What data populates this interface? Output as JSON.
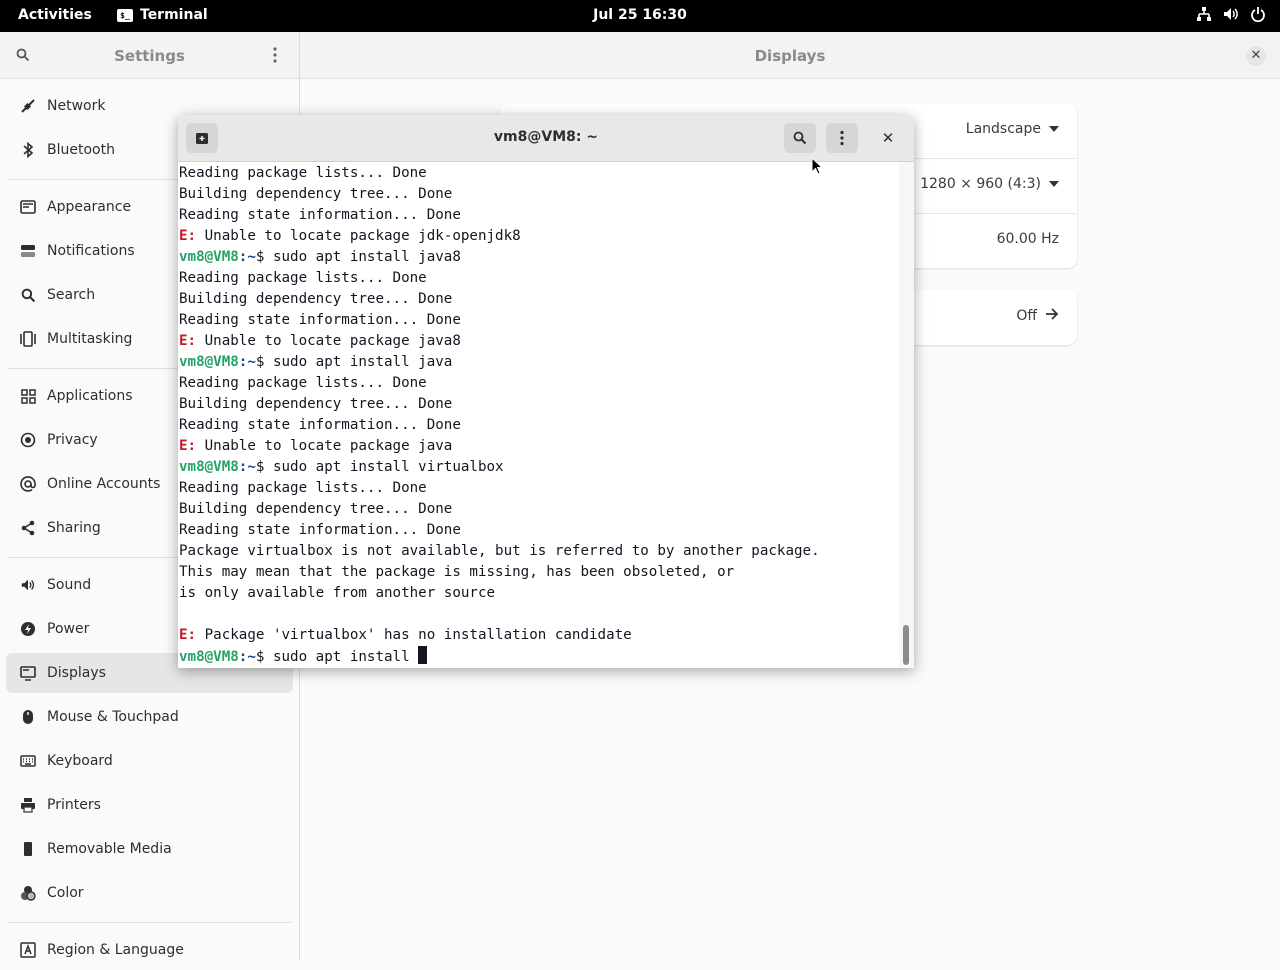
{
  "topbar": {
    "activities": "Activities",
    "app_name": "Terminal",
    "app_icon_text": "$_",
    "clock": "Jul 25  16:30"
  },
  "settings": {
    "title": "Settings",
    "nav": [
      {
        "label": "Network",
        "icon": "network-icon"
      },
      {
        "label": "Bluetooth",
        "icon": "bluetooth-icon"
      },
      {
        "label": "Appearance",
        "icon": "appearance-icon"
      },
      {
        "label": "Notifications",
        "icon": "notifications-icon"
      },
      {
        "label": "Search",
        "icon": "search-icon"
      },
      {
        "label": "Multitasking",
        "icon": "multitasking-icon"
      },
      {
        "label": "Applications",
        "icon": "applications-icon"
      },
      {
        "label": "Privacy",
        "icon": "privacy-icon"
      },
      {
        "label": "Online Accounts",
        "icon": "online-accounts-icon"
      },
      {
        "label": "Sharing",
        "icon": "sharing-icon"
      },
      {
        "label": "Sound",
        "icon": "sound-icon"
      },
      {
        "label": "Power",
        "icon": "power-icon"
      },
      {
        "label": "Displays",
        "icon": "displays-icon",
        "active": true
      },
      {
        "label": "Mouse & Touchpad",
        "icon": "mouse-icon"
      },
      {
        "label": "Keyboard",
        "icon": "keyboard-icon"
      },
      {
        "label": "Printers",
        "icon": "printer-icon"
      },
      {
        "label": "Removable Media",
        "icon": "removable-media-icon"
      },
      {
        "label": "Color",
        "icon": "color-icon"
      },
      {
        "label": "Region & Language",
        "icon": "region-language-icon"
      }
    ]
  },
  "displays": {
    "title": "Displays",
    "orientation": "Landscape",
    "resolution": "1280 × 960 (4:3)",
    "refresh_rate": "60.00 Hz",
    "night_light": "Off"
  },
  "terminal": {
    "title": "vm8@VM8: ~",
    "prompt_user": "vm8@VM8",
    "prompt_path": ":~",
    "lines": [
      {
        "type": "out",
        "text": "Reading package lists... Done"
      },
      {
        "type": "out",
        "text": "Building dependency tree... Done"
      },
      {
        "type": "out",
        "text": "Reading state information... Done"
      },
      {
        "type": "err",
        "prefix": "E:",
        "text": " Unable to locate package jdk-openjdk8"
      },
      {
        "type": "cmd",
        "text": "$ sudo apt install java8"
      },
      {
        "type": "out",
        "text": "Reading package lists... Done"
      },
      {
        "type": "out",
        "text": "Building dependency tree... Done"
      },
      {
        "type": "out",
        "text": "Reading state information... Done"
      },
      {
        "type": "err",
        "prefix": "E:",
        "text": " Unable to locate package java8"
      },
      {
        "type": "cmd",
        "text": "$ sudo apt install java"
      },
      {
        "type": "out",
        "text": "Reading package lists... Done"
      },
      {
        "type": "out",
        "text": "Building dependency tree... Done"
      },
      {
        "type": "out",
        "text": "Reading state information... Done"
      },
      {
        "type": "err",
        "prefix": "E:",
        "text": " Unable to locate package java"
      },
      {
        "type": "cmd",
        "text": "$ sudo apt install virtualbox"
      },
      {
        "type": "out",
        "text": "Reading package lists... Done"
      },
      {
        "type": "out",
        "text": "Building dependency tree... Done"
      },
      {
        "type": "out",
        "text": "Reading state information... Done"
      },
      {
        "type": "out",
        "text": "Package virtualbox is not available, but is referred to by another package."
      },
      {
        "type": "out",
        "text": "This may mean that the package is missing, has been obsoleted, or"
      },
      {
        "type": "out",
        "text": "is only available from another source"
      },
      {
        "type": "out",
        "text": ""
      },
      {
        "type": "err",
        "prefix": "E:",
        "text": " Package 'virtualbox' has no installation candidate"
      },
      {
        "type": "cmd",
        "text": "$ sudo apt install ",
        "cursor": true
      }
    ]
  },
  "colors": {
    "prompt_user": "#26a269",
    "prompt_path": "#12488b",
    "error": "#c01c28",
    "topbar_bg": "#000000"
  }
}
